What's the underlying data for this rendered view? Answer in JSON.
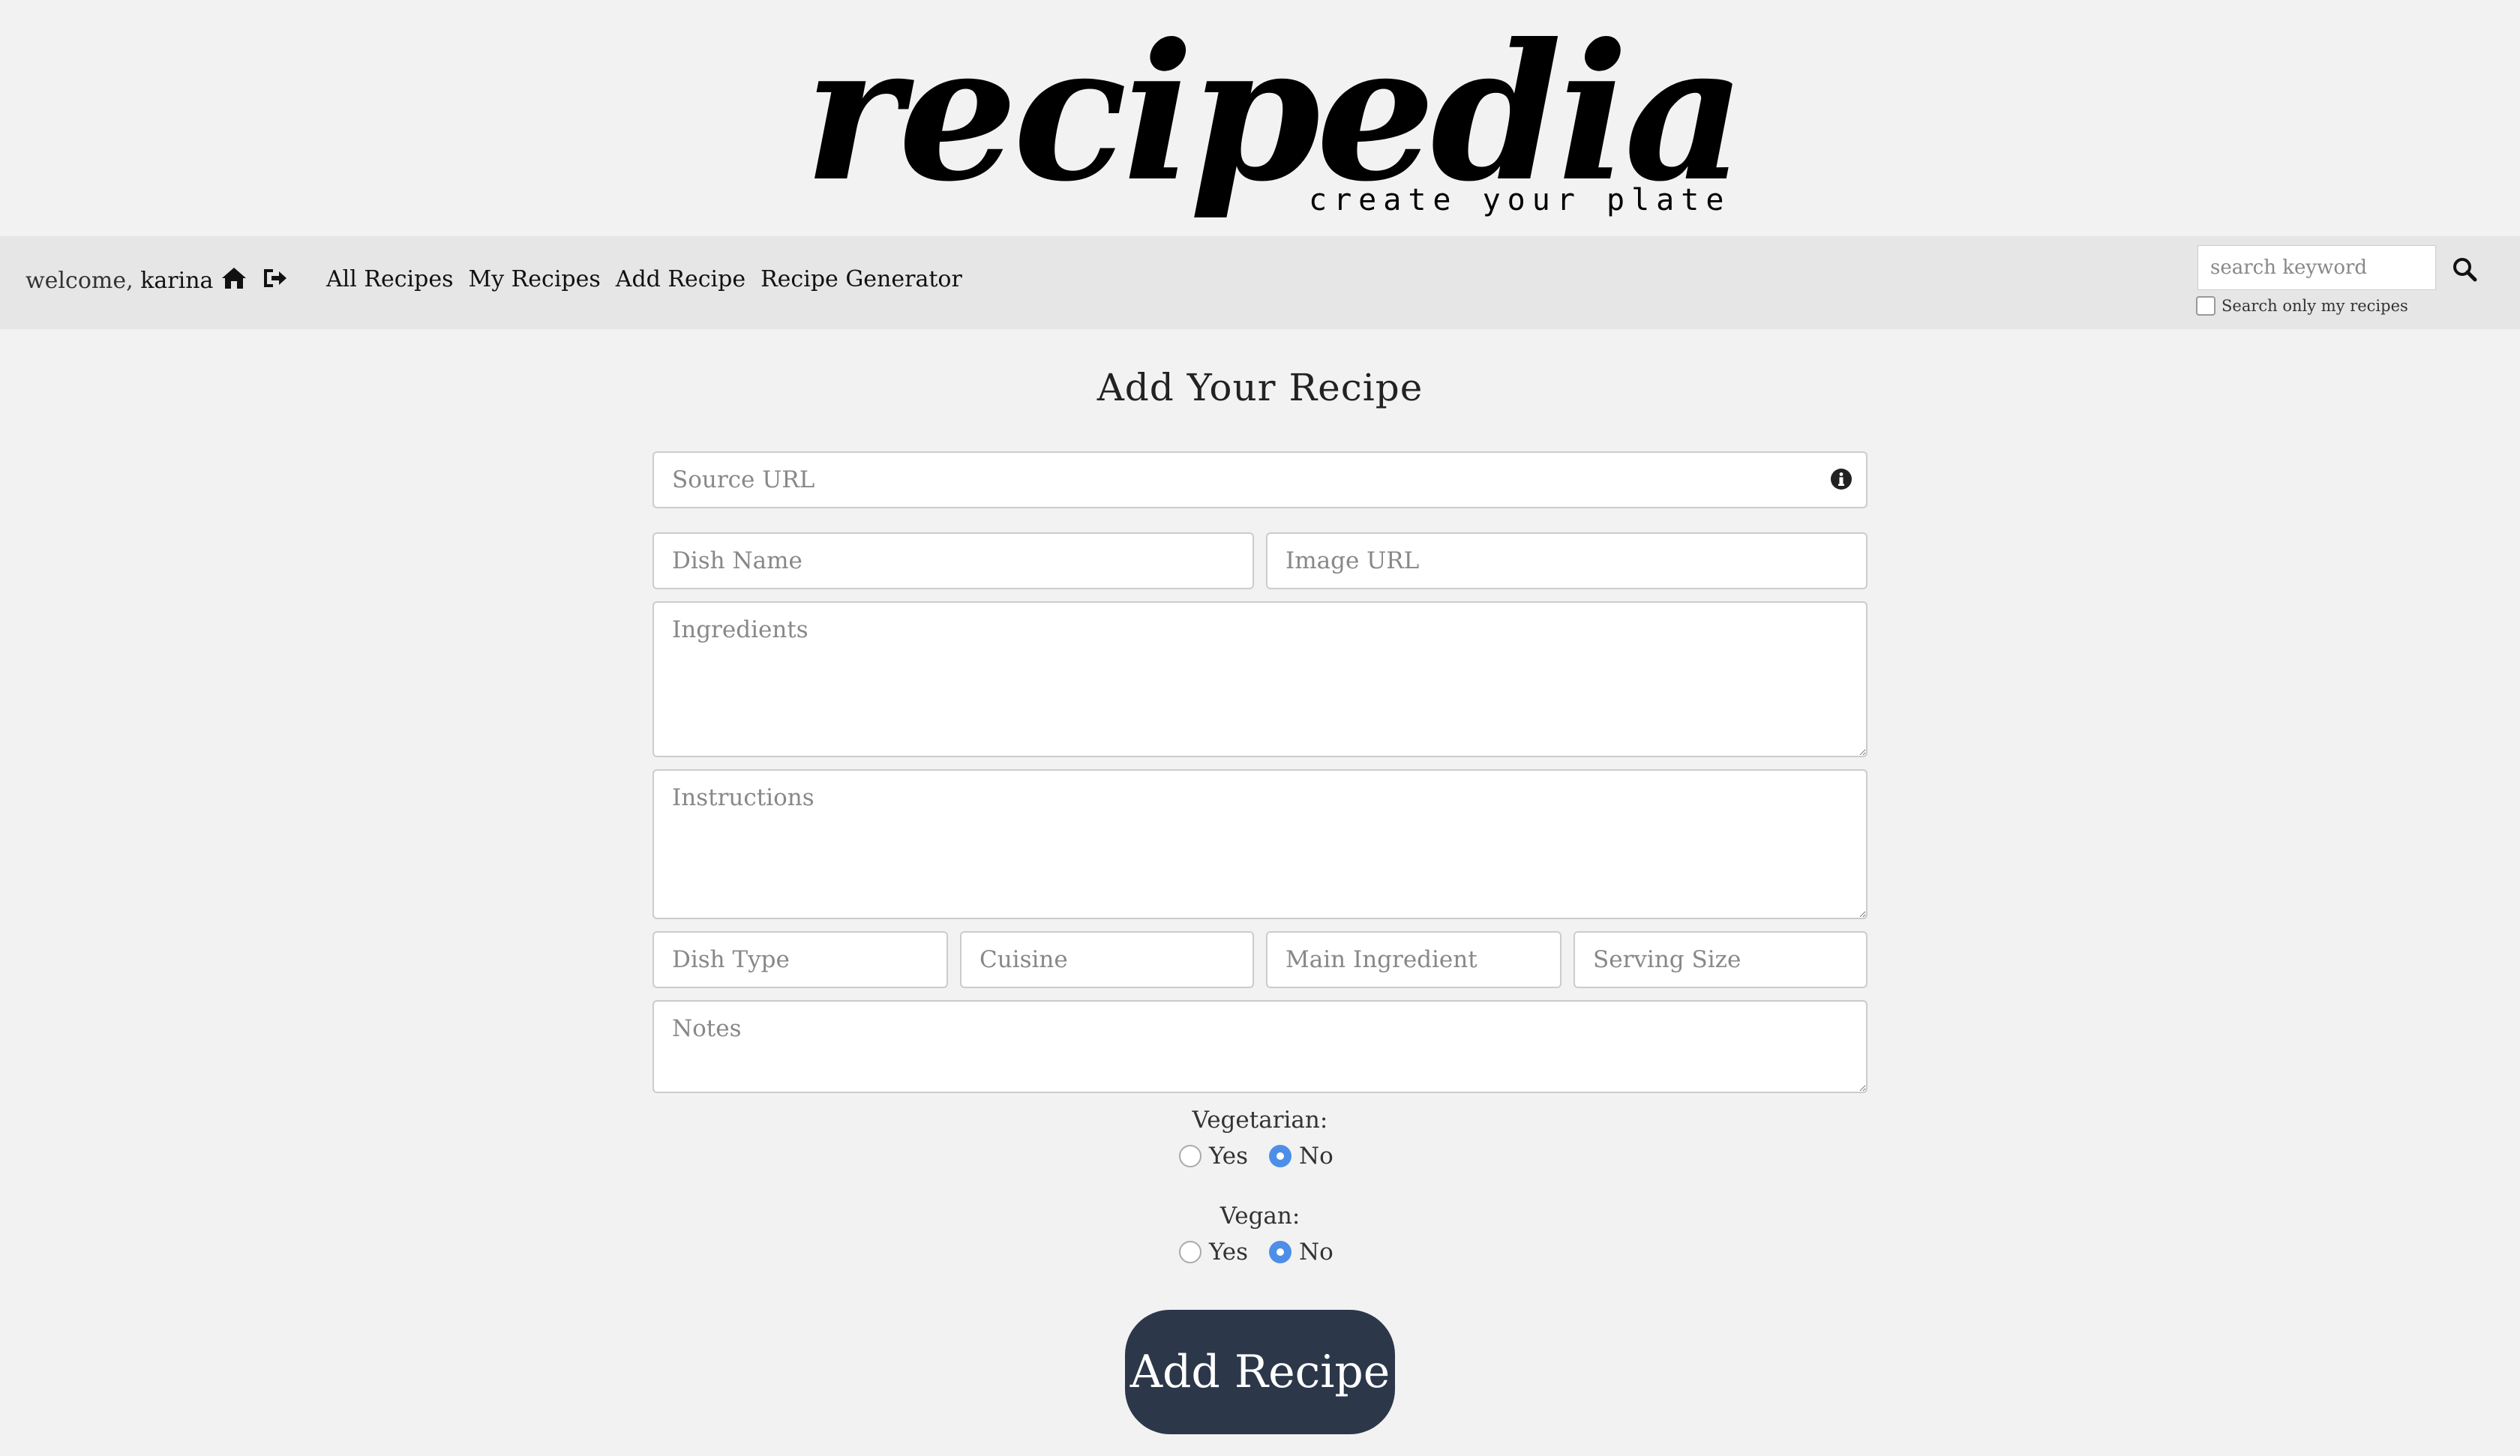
{
  "header": {
    "logo_text": "recipedia",
    "tagline": "create your plate"
  },
  "navbar": {
    "welcome_prefix": "welcome,",
    "username": "karina",
    "icons": [
      "home-icon",
      "logout-icon"
    ],
    "links": [
      {
        "label": "All Recipes"
      },
      {
        "label": "My Recipes"
      },
      {
        "label": "Add Recipe"
      },
      {
        "label": "Recipe Generator"
      }
    ],
    "search": {
      "placeholder": "search keyword",
      "only_mine_label": "Search only my recipes",
      "only_mine_checked": false
    }
  },
  "form": {
    "title": "Add Your Recipe",
    "source_url_placeholder": "Source URL",
    "dish_name_placeholder": "Dish Name",
    "image_url_placeholder": "Image URL",
    "ingredients_placeholder": "Ingredients",
    "instructions_placeholder": "Instructions",
    "dish_type_placeholder": "Dish Type",
    "cuisine_placeholder": "Cuisine",
    "main_ingredient_placeholder": "Main Ingredient",
    "serving_size_placeholder": "Serving Size",
    "notes_placeholder": "Notes",
    "vegetarian": {
      "label": "Vegetarian:",
      "options": [
        "Yes",
        "No"
      ],
      "selected": "No"
    },
    "vegan": {
      "label": "Vegan:",
      "options": [
        "Yes",
        "No"
      ],
      "selected": "No"
    },
    "submit_label": "Add Recipe"
  },
  "colors": {
    "page_bg": "#f2f2f2",
    "navbar_bg": "#e6e6e6",
    "button_bg": "#2c374a",
    "radio_selected": "#4d8fe8"
  }
}
